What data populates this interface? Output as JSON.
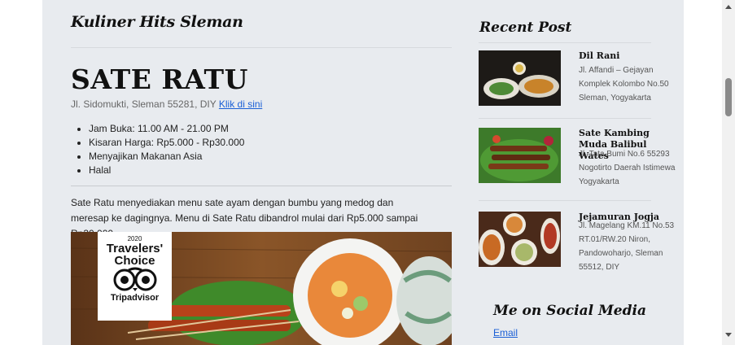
{
  "site": {
    "title": "Kuliner Hits Sleman"
  },
  "post": {
    "title": "SATE RATU",
    "address": "Jl. Sidomukti, Sleman 55281, DIY",
    "map_link": "Klik di sini",
    "facts": [
      "Jam Buka: 11.00 AM - 21.00 PM",
      "Kisaran Harga: Rp5.000 - Rp30.000",
      "Menyajikan Makanan Asia",
      "Halal"
    ],
    "description": "Sate Ratu menyediakan menu sate ayam dengan bumbu yang medog dan meresap ke dagingnya. Menu di Sate Ratu dibandrol mulai dari Rp5.000 sampai Rp30.000.",
    "badge": {
      "year": "2020",
      "line1": "Travelers'",
      "line2": "Choice",
      "brand": "Tripadvisor"
    }
  },
  "sidebar": {
    "recent_heading": "Recent Post",
    "posts": [
      {
        "name": "Dil Rani",
        "address": "Jl. Affandi – Gejayan Komplek Kolombo No.50 Sleman, Yogyakarta"
      },
      {
        "name": "Sate Kambing Muda Balibul Wates",
        "address": "Jl. Tata Bumi No.6 55293 Nogotirto Daerah Istimewa Yogyakarta"
      },
      {
        "name": "Jejamuran Jogja",
        "address": "Jl. Magelang KM.11 No.53 RT.01/RW.20 Niron, Pandowoharjo, Sleman 55512, DIY"
      }
    ],
    "social_heading": "Me on Social Media",
    "email_label": "Email"
  },
  "colors": {
    "link": "#1a5fd6",
    "page_bg": "#e8ebef"
  }
}
